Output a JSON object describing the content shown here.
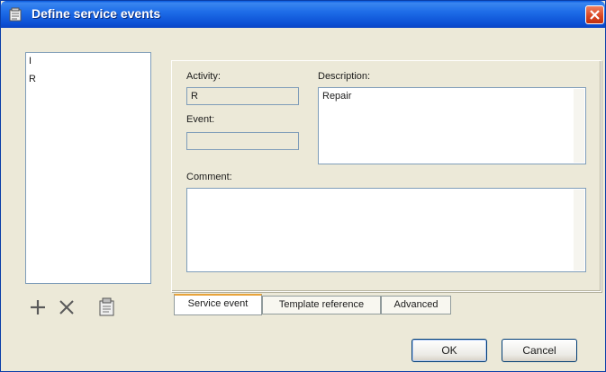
{
  "window": {
    "title": "Define service events"
  },
  "list": {
    "items": [
      "I",
      "R"
    ]
  },
  "toolbar": {
    "add_icon": "plus-icon",
    "delete_icon": "x-icon",
    "properties_icon": "properties-icon"
  },
  "form": {
    "activity_label": "Activity:",
    "activity_value": "R",
    "event_label": "Event:",
    "event_value": "",
    "description_label": "Description:",
    "description_value": "Repair",
    "comment_label": "Comment:",
    "comment_value": ""
  },
  "tabs": [
    "Service event",
    "Template reference",
    "Advanced"
  ],
  "buttons": {
    "ok": "OK",
    "cancel": "Cancel"
  },
  "colors": {
    "titlebar": "#0b4fd4",
    "dialog_bg": "#ece9d8",
    "close": "#d7441f"
  }
}
